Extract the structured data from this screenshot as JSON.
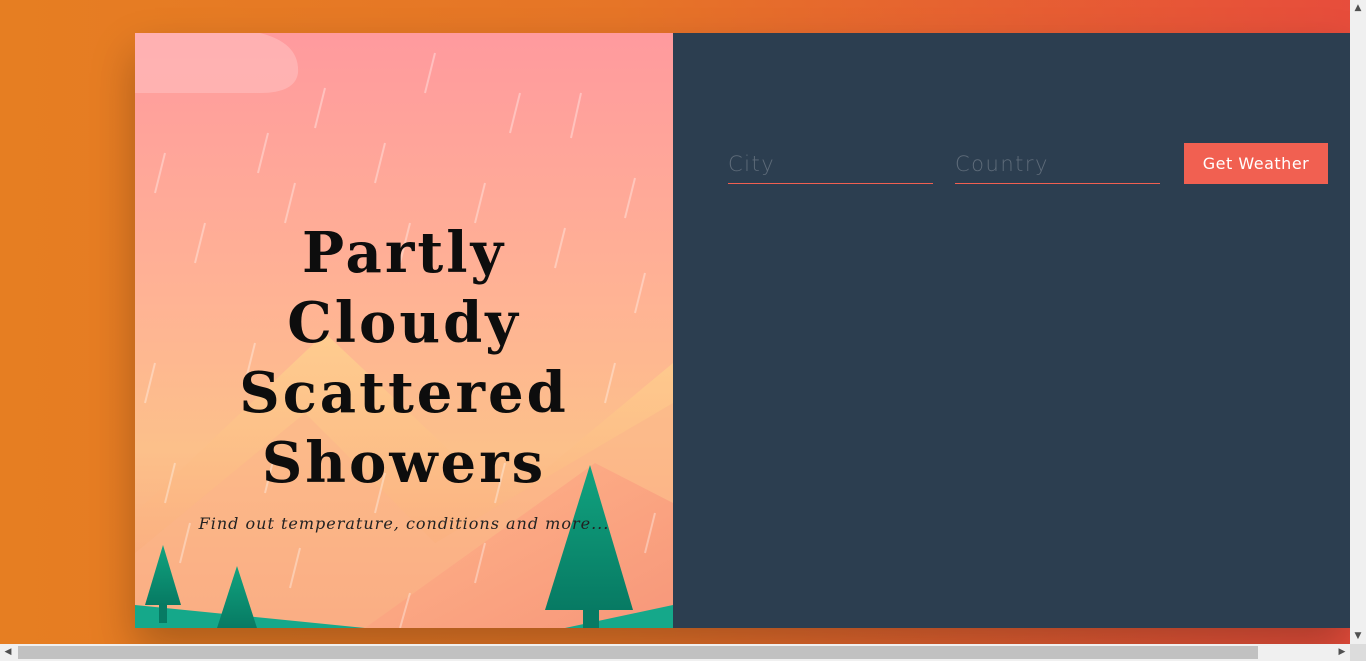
{
  "hero": {
    "title_line1": "Partly Cloudy",
    "title_line2": "Scattered",
    "title_line3": "Showers",
    "subtitle": "Find out temperature, conditions and more..."
  },
  "form": {
    "city_placeholder": "City",
    "country_placeholder": "Country",
    "city_value": "",
    "country_value": "",
    "submit_label": "Get Weather"
  },
  "icons": {
    "scroll_up": "scroll-up-arrow-icon",
    "scroll_down": "scroll-down-arrow-icon",
    "scroll_left": "scroll-left-arrow-icon",
    "scroll_right": "scroll-right-arrow-icon",
    "tree": "pine-tree-icon"
  },
  "colors": {
    "page_background_start": "#e67e22",
    "page_background_end": "#e74c3c",
    "panel_background": "#2c3e50",
    "accent": "#f16051",
    "tree_green": "#0e8f72"
  }
}
